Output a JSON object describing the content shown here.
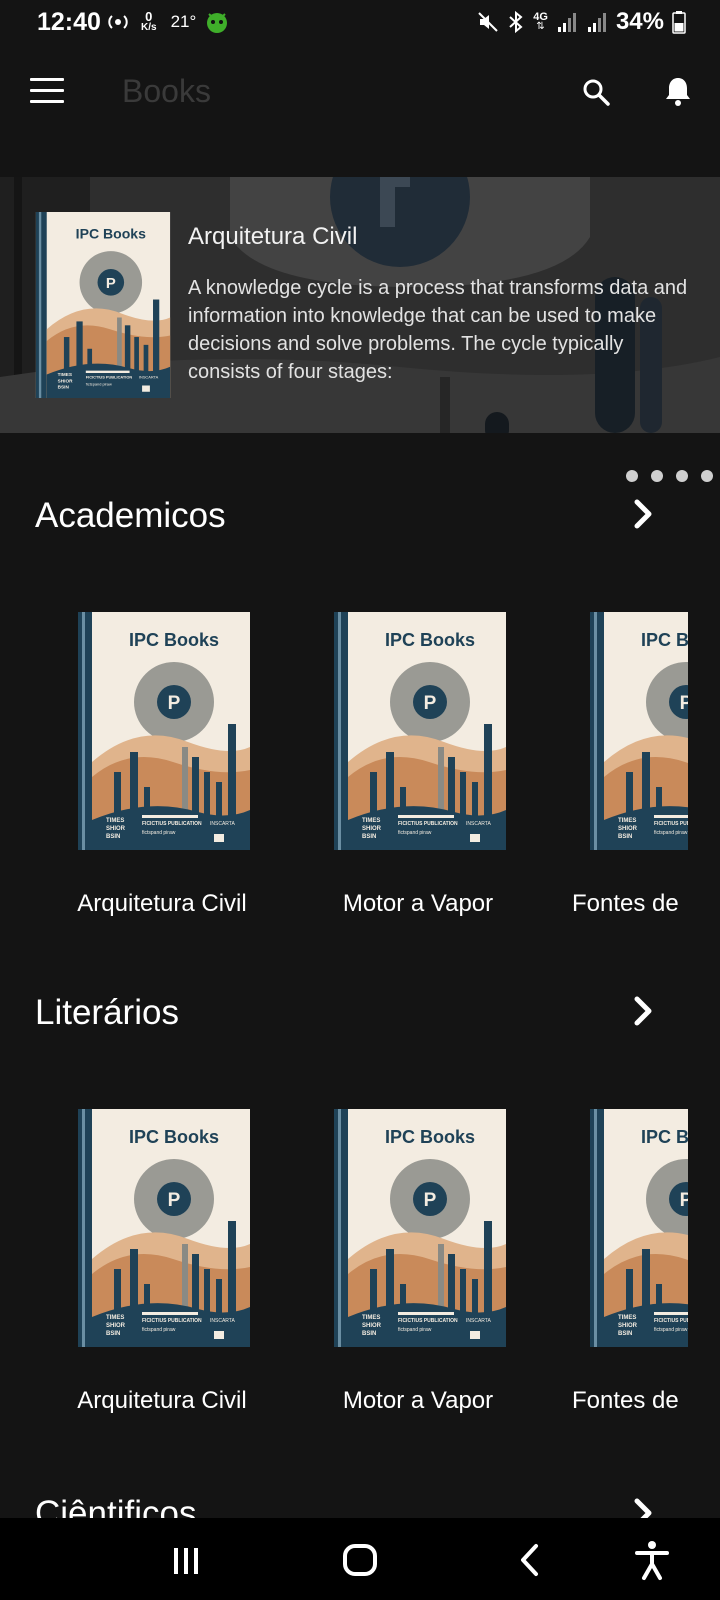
{
  "status_bar": {
    "time": "12:40",
    "speed_value": "0",
    "speed_unit": "K/s",
    "temperature": "21°",
    "network": "4G",
    "battery": "34%"
  },
  "app_bar": {
    "title": "Books",
    "menu_icon": "menu-icon",
    "search_icon": "search-icon",
    "bell_icon": "bell-icon"
  },
  "hero": {
    "title": "Arquitetura Civil",
    "description": "A knowledge cycle is a process that transforms data and information into knowledge that can be used to make decisions and solve problems. The cycle typically consists of four stages:",
    "page_count": 4
  },
  "cover_art": {
    "brand": "IPC Books",
    "footer_left": [
      "TIMES",
      "SHIOR",
      "BSIN"
    ],
    "footer_mid": "FICICTIUS PUBLICATION",
    "footer_mid2": "fictspand piraw",
    "footer_right": "INSCARTA",
    "colors": {
      "paper": "#f3ece1",
      "navy": "#1f4257",
      "terracotta": "#c98a5a",
      "sand": "#e0b48c",
      "gray_circle": "#9a9a94"
    }
  },
  "sections": [
    {
      "title": "Academicos",
      "books": [
        {
          "title": "Arquitetura Civil"
        },
        {
          "title": "Motor a Vapor"
        },
        {
          "title": "Fontes de"
        }
      ]
    },
    {
      "title": "Literários",
      "books": [
        {
          "title": "Arquitetura Civil"
        },
        {
          "title": "Motor a Vapor"
        },
        {
          "title": "Fontes de"
        }
      ]
    },
    {
      "title": "Ciêntificos"
    }
  ],
  "nav": {
    "recents_icon": "recent-apps-icon",
    "home_icon": "home-icon",
    "back_icon": "back-icon",
    "accessibility_icon": "accessibility-icon"
  }
}
